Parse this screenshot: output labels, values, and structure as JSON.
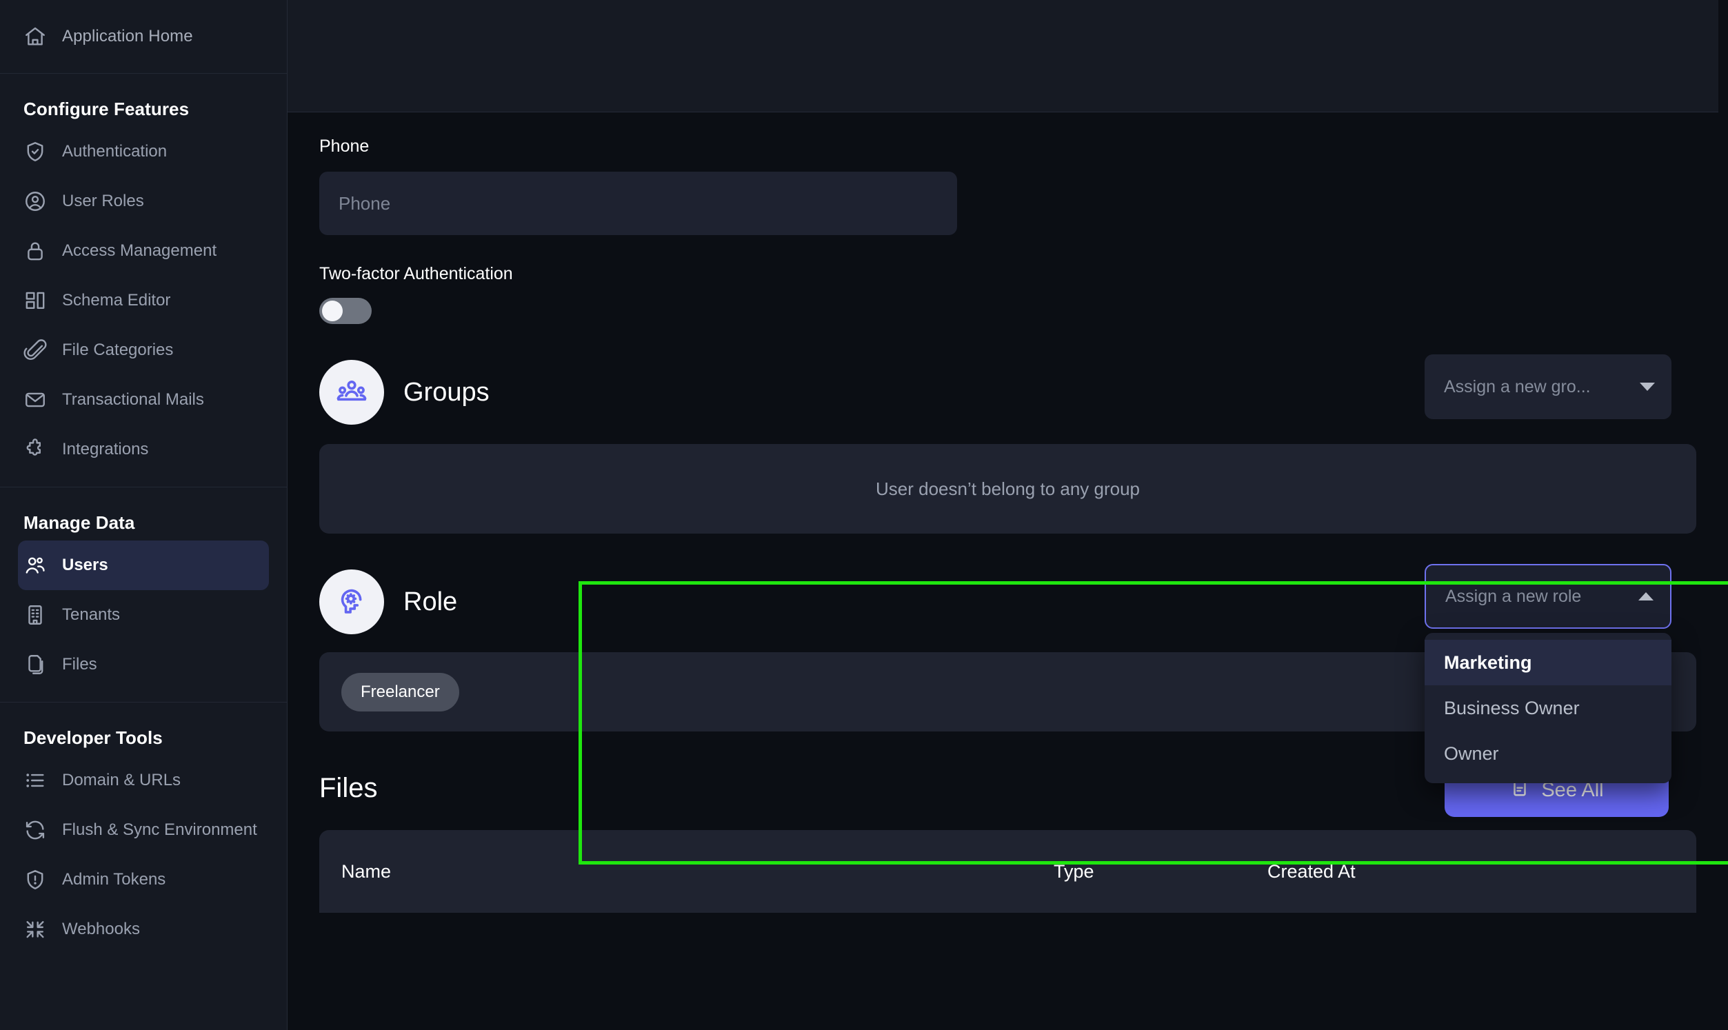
{
  "sidebar": {
    "home": {
      "label": "Application Home",
      "icon": "home-icon"
    },
    "groups": [
      {
        "title": "Configure Features",
        "items": [
          {
            "label": "Authentication",
            "icon": "shield-check-icon",
            "active": false
          },
          {
            "label": "User Roles",
            "icon": "user-circle-icon",
            "active": false
          },
          {
            "label": "Access Management",
            "icon": "lock-icon",
            "active": false
          },
          {
            "label": "Schema Editor",
            "icon": "layout-blocks-icon",
            "active": false
          },
          {
            "label": "File Categories",
            "icon": "paperclip-icon",
            "active": false
          },
          {
            "label": "Transactional Mails",
            "icon": "envelope-icon",
            "active": false
          },
          {
            "label": "Integrations",
            "icon": "puzzle-icon",
            "active": false
          }
        ]
      },
      {
        "title": "Manage Data",
        "items": [
          {
            "label": "Users",
            "icon": "users-icon",
            "active": true
          },
          {
            "label": "Tenants",
            "icon": "building-icon",
            "active": false
          },
          {
            "label": "Files",
            "icon": "files-icon",
            "active": false
          }
        ]
      },
      {
        "title": "Developer Tools",
        "items": [
          {
            "label": "Domain & URLs",
            "icon": "list-icon",
            "active": false
          },
          {
            "label": "Flush & Sync Environment",
            "icon": "refresh-icon",
            "active": false
          },
          {
            "label": "Admin Tokens",
            "icon": "shield-alert-icon",
            "active": false
          },
          {
            "label": "Webhooks",
            "icon": "collapse-arrows-icon",
            "active": false
          }
        ]
      }
    ]
  },
  "main": {
    "phone": {
      "label": "Phone",
      "placeholder": "Phone",
      "value": ""
    },
    "two_factor": {
      "label": "Two-factor Authentication",
      "enabled": false
    },
    "groups_section": {
      "title": "Groups",
      "icon": "group-people-icon",
      "assign_placeholder": "Assign a new gro...",
      "empty_message": "User doesn’t belong to any group"
    },
    "role_section": {
      "title": "Role",
      "icon": "head-gear-icon",
      "assign_placeholder": "Assign a new role",
      "dropdown_open": true,
      "options": [
        {
          "label": "Marketing",
          "highlighted": true
        },
        {
          "label": "Business Owner",
          "highlighted": false
        },
        {
          "label": "Owner",
          "highlighted": false
        }
      ],
      "assigned_roles": [
        "Freelancer"
      ]
    },
    "files_section": {
      "title": "Files",
      "see_all_label": "See All",
      "see_all_icon": "document-icon",
      "columns": [
        "Name",
        "Type",
        "Created At"
      ],
      "rows": []
    }
  },
  "colors": {
    "accent": "#6466f1",
    "highlight_outline": "#1fe60f",
    "sidebar_bg": "#151922",
    "main_bg": "#0b0e14",
    "panel_bg": "#1f2330"
  }
}
